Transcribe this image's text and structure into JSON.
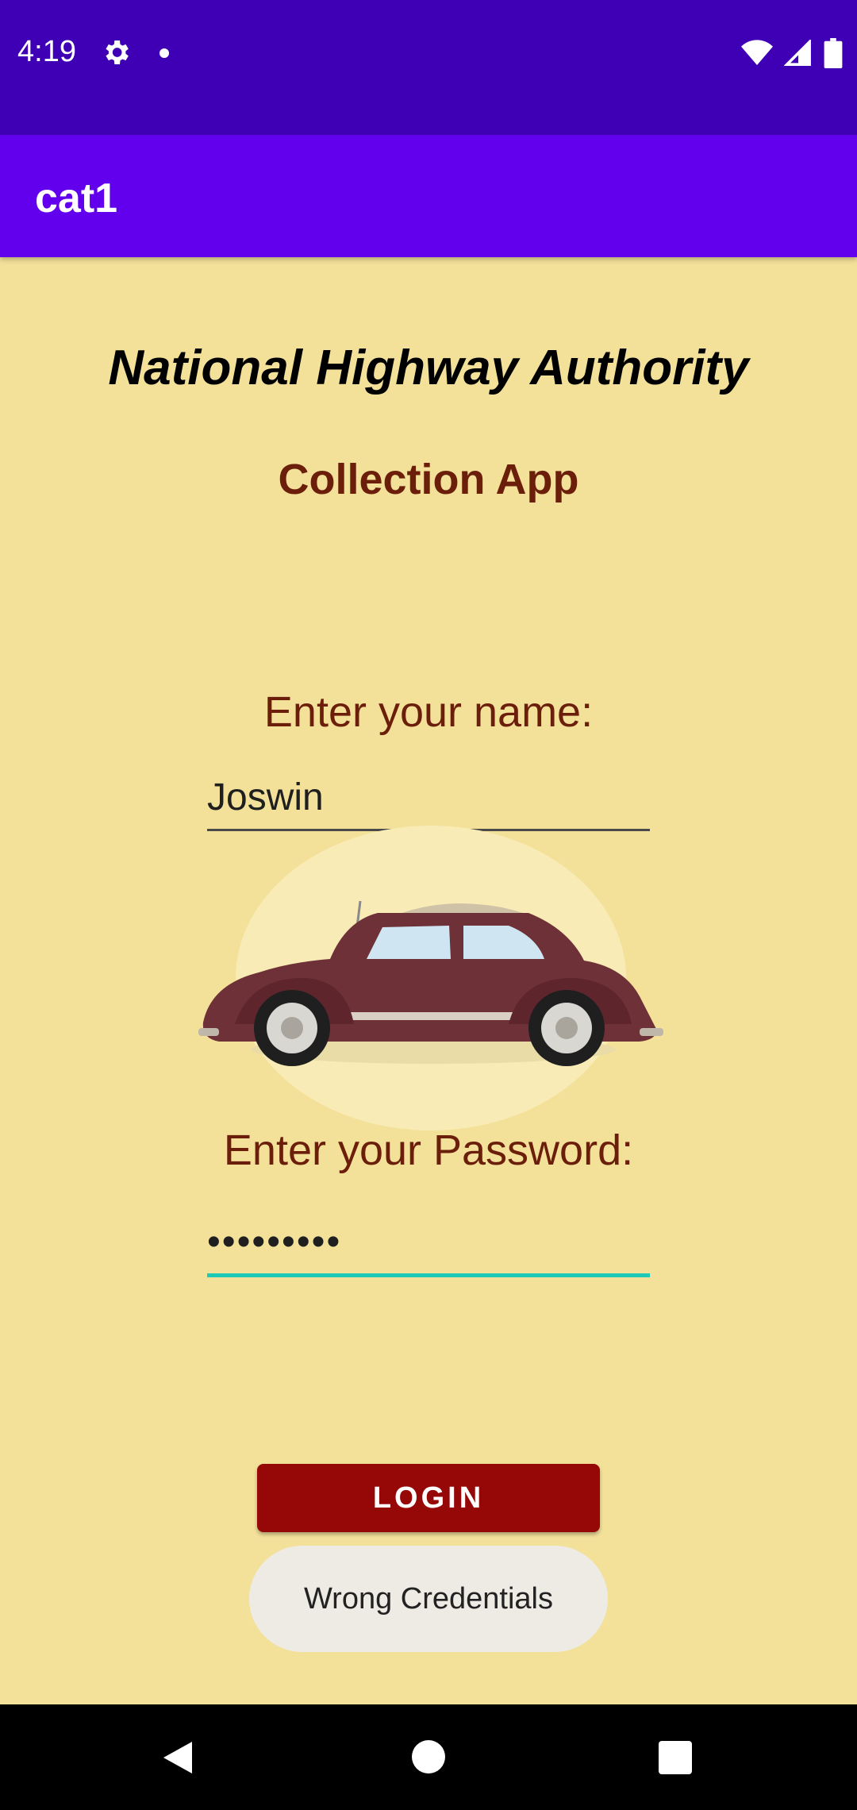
{
  "status_bar": {
    "time": "4:19",
    "icons": [
      "gear-icon",
      "notification-dot-icon",
      "wifi-icon",
      "cellular-signal-icon",
      "battery-icon"
    ]
  },
  "app_bar": {
    "title": "cat1"
  },
  "main": {
    "heading": "National Highway Authority",
    "subheading": "Collection App",
    "name_label": "Enter your name:",
    "name_value": "Joswin",
    "password_label": "Enter your Password:",
    "password_value": "•••••••••",
    "login_label": "LOGIN"
  },
  "toast": {
    "message": "Wrong Credentials"
  },
  "nav_bar": {
    "icons": [
      "back-icon",
      "home-icon",
      "recents-icon"
    ]
  },
  "colors": {
    "status_bar": "#3F00B5",
    "app_bar": "#6200EE",
    "background": "#F3E19A",
    "label_text": "#6B1F0B",
    "login_button": "#960707",
    "active_underline": "#1DC9B7"
  }
}
